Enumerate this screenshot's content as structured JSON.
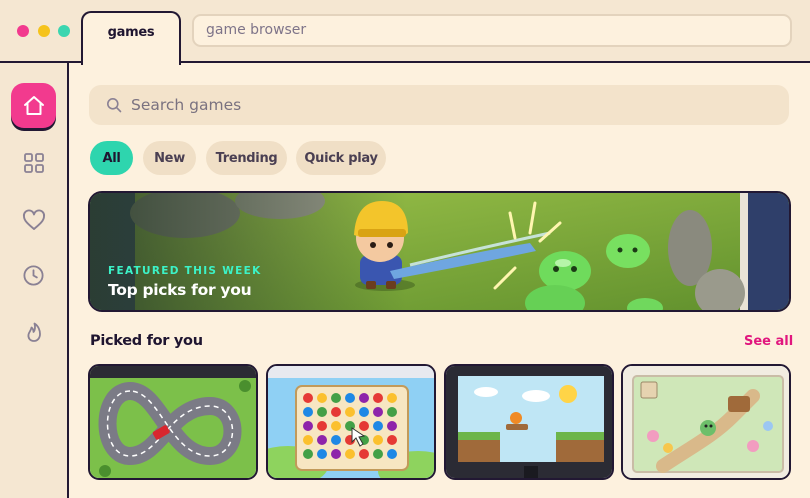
{
  "window": {
    "tab_label": "games",
    "url": "game browser",
    "controls": {
      "close_color": "#f23a8e",
      "minimize_color": "#f5c31c",
      "maximize_color": "#3bd6b0"
    }
  },
  "sidebar": {
    "items": [
      {
        "icon": "home-icon",
        "active": true
      },
      {
        "icon": "grid-icon",
        "active": false
      },
      {
        "icon": "heart-icon",
        "active": false
      },
      {
        "icon": "clock-icon",
        "active": false
      },
      {
        "icon": "flame-icon",
        "active": false
      }
    ]
  },
  "search": {
    "placeholder": "Search games"
  },
  "filters": [
    "All",
    "New",
    "Trending",
    "Quick play"
  ],
  "featured": {
    "kicker": "FEATURED THIS WEEK",
    "title": "Top picks for you"
  },
  "picked": {
    "title": "Picked for you",
    "see_all": "See all",
    "cards": [
      {
        "name": "racing-track-game"
      },
      {
        "name": "match-three-game"
      },
      {
        "name": "platformer-game"
      },
      {
        "name": "garden-adventure-game"
      }
    ]
  },
  "colors": {
    "accent_pink": "#f23a8e",
    "accent_teal": "#2ed5ae",
    "background": "#fdf1de",
    "outline": "#221833"
  }
}
